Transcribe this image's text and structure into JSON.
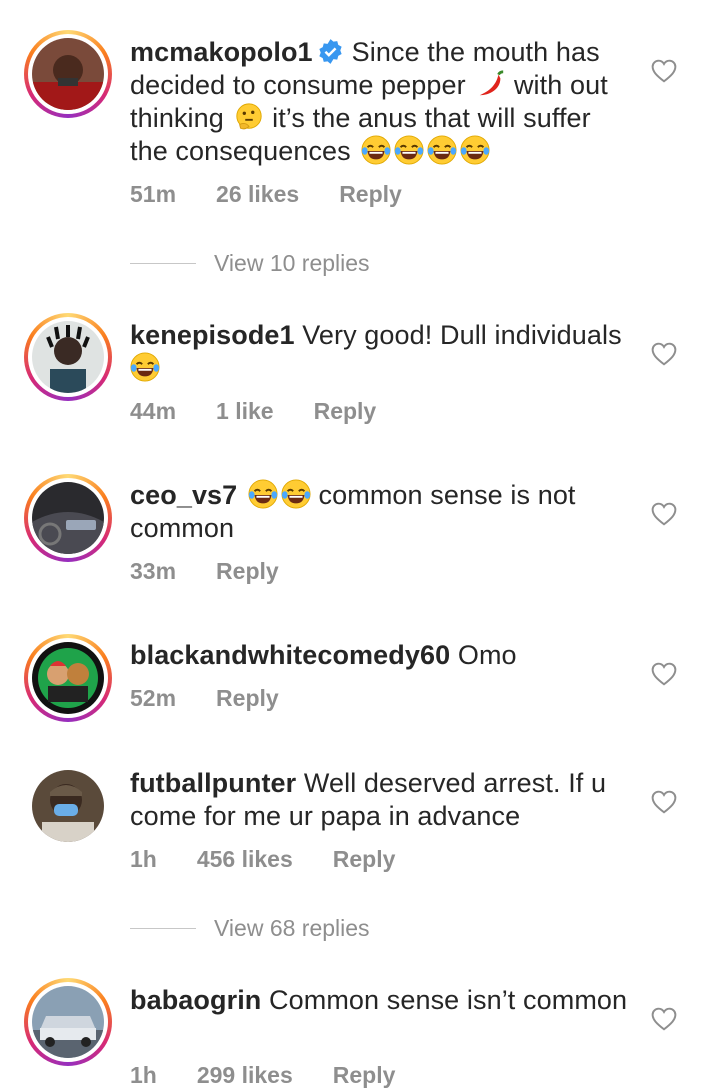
{
  "comments": [
    {
      "username": "mcmakopolo1",
      "verified": true,
      "text_parts": [
        "Since the mouth has decided to consume pepper",
        "with out thinking",
        "it’s the anus that will suffer the consequences"
      ],
      "emojis": [
        "hot-pepper-emoji",
        "thinking-face-emoji",
        "face-with-tears-of-joy-emoji"
      ],
      "time": "51m",
      "likes": "26 likes",
      "reply": "Reply"
    },
    {
      "username": "kenepisode1",
      "text": "Very good! Dull individuals",
      "time": "44m",
      "likes": "1 like",
      "reply": "Reply"
    },
    {
      "username": "ceo_vs7",
      "text": "common sense is not common",
      "time": "33m",
      "reply": "Reply"
    },
    {
      "username": "blackandwhitecomedy60",
      "text": "Omo",
      "time": "52m",
      "reply": "Reply"
    },
    {
      "username": "futballpunter",
      "text": "Well deserved arrest. If u come for me ur papa in advance",
      "time": "1h",
      "likes": "456 likes",
      "reply": "Reply"
    },
    {
      "username": "babaogrin",
      "text": "Common sense isn’t common",
      "time": "1h",
      "likes": "299 likes",
      "reply": "Reply"
    }
  ],
  "view_replies": [
    "View 10 replies",
    "View 68 replies"
  ],
  "colors": {
    "text": "#262626",
    "meta": "#8e8e8e",
    "verified": "#3897f0"
  }
}
